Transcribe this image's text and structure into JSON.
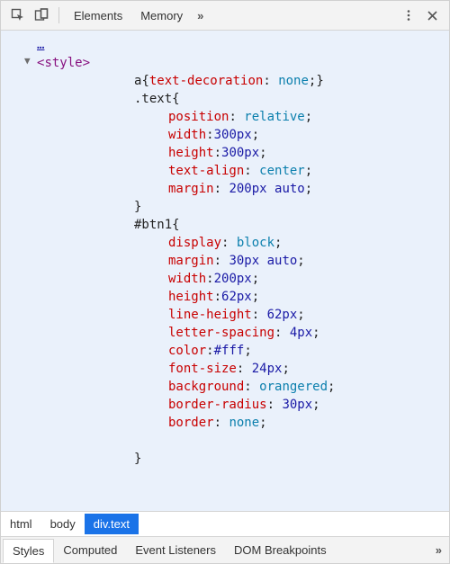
{
  "toolbar": {
    "tabs": [
      "Elements",
      "Memory"
    ],
    "more": "»"
  },
  "code": {
    "truncated_prefix": "…",
    "open_tag_lt": "<",
    "open_tag_name": "style",
    "open_tag_gt": ">",
    "rule_a_sel": "a",
    "rule_a_open": "{",
    "rule_a_prop": "text-decoration",
    "rule_a_val": "none",
    "rule_a_close": ";}",
    "rule_text_sel": ".text",
    "brace_open": "{",
    "brace_close": "}",
    "semi": ";",
    "colon": ":",
    "props_text": [
      {
        "prop": "position",
        "val": "relative"
      },
      {
        "prop": "width",
        "val": "300px"
      },
      {
        "prop": "height",
        "val": "300px"
      },
      {
        "prop": "text-align",
        "val": "center"
      },
      {
        "prop": "margin",
        "val": "200px auto"
      }
    ],
    "rule_btn_sel": "#btn1",
    "props_btn": [
      {
        "prop": "display",
        "val": "block"
      },
      {
        "prop": "margin",
        "val": "30px auto"
      },
      {
        "prop": "width",
        "val": "200px"
      },
      {
        "prop": "height",
        "val": "62px"
      },
      {
        "prop": "line-height",
        "val": "62px"
      },
      {
        "prop": "letter-spacing",
        "val": "4px"
      },
      {
        "prop": "color",
        "val": "#fff"
      },
      {
        "prop": "font-size",
        "val": "24px"
      },
      {
        "prop": "background",
        "val": "orangered"
      },
      {
        "prop": "border-radius",
        "val": "30px"
      },
      {
        "prop": "border",
        "val": "none"
      }
    ]
  },
  "breadcrumbs": [
    "html",
    "body",
    "div.text"
  ],
  "bottom_tabs": [
    "Styles",
    "Computed",
    "Event Listeners",
    "DOM Breakpoints"
  ],
  "bottom_more": "»"
}
